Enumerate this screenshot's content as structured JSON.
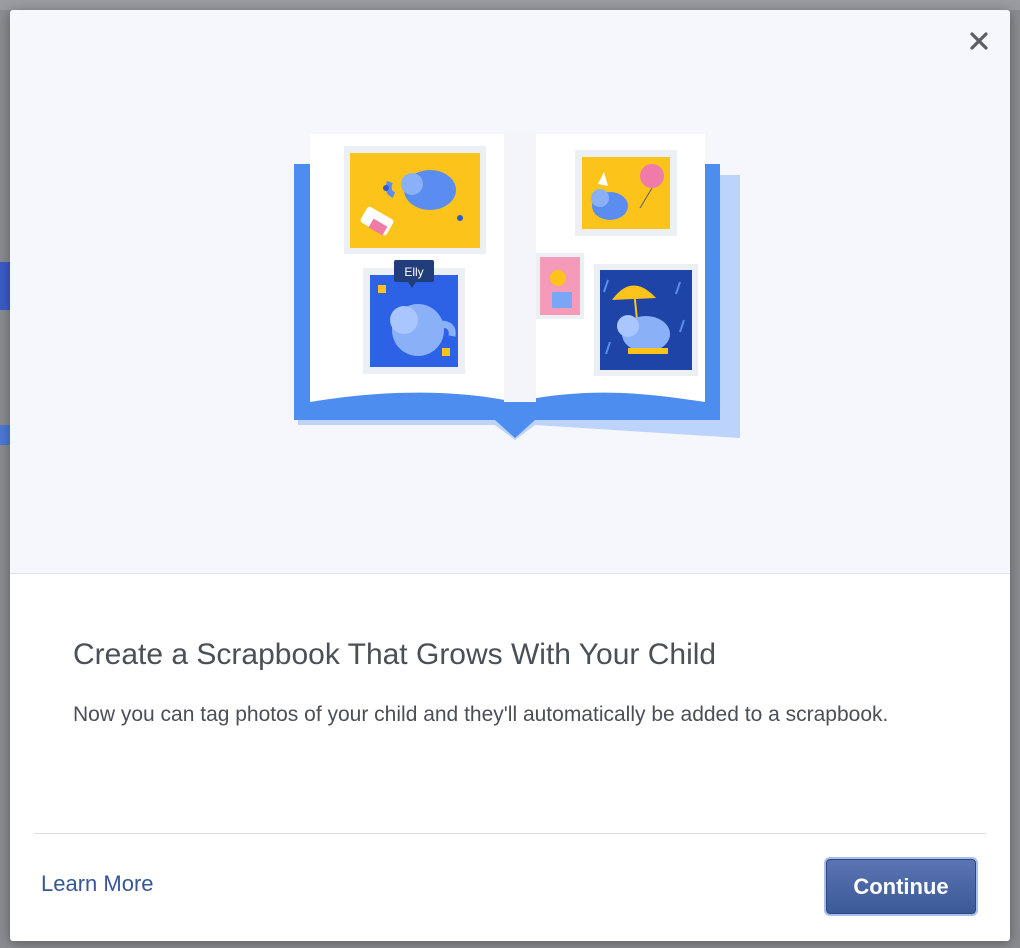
{
  "dialog": {
    "close_icon": "close-icon",
    "illustration": {
      "tag_label": "Elly"
    },
    "title": "Create a Scrapbook That Grows With Your Child",
    "description": "Now you can tag photos of your child and they'll automatically be added to a scrapbook.",
    "learn_more_label": "Learn More",
    "continue_label": "Continue"
  },
  "colors": {
    "brand": "#3b5998",
    "link": "#365899",
    "text": "#4b4f56",
    "hero_background": "#f5f7fc"
  }
}
